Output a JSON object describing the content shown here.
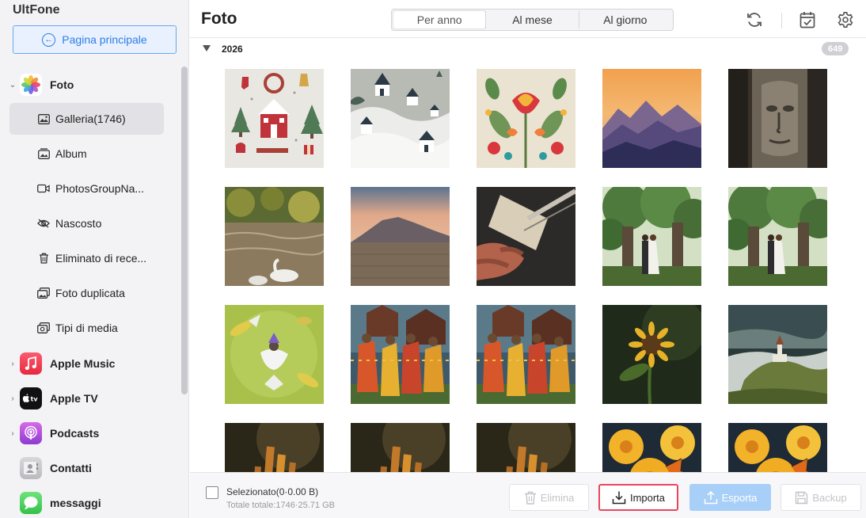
{
  "app": {
    "title": "UltFone",
    "home_button": "Pagina principale"
  },
  "sidebar": {
    "photos_label": "Foto",
    "sub_items": [
      {
        "label": "Galleria(1746)",
        "icon": "gallery-icon",
        "active": true
      },
      {
        "label": "Album",
        "icon": "album-icon"
      },
      {
        "label": "PhotosGroupNa...",
        "icon": "video-icon"
      },
      {
        "label": "Nascosto",
        "icon": "eye-hidden-icon"
      },
      {
        "label": "Eliminato di rece...",
        "icon": "trash-icon"
      },
      {
        "label": "Foto duplicata",
        "icon": "duplicate-photo-icon"
      },
      {
        "label": "Tipi di media",
        "icon": "media-types-icon"
      }
    ],
    "categories": [
      {
        "label": "Apple Music",
        "icon": "apple-music-icon"
      },
      {
        "label": "Apple TV",
        "icon": "apple-tv-icon"
      },
      {
        "label": "Podcasts",
        "icon": "podcasts-icon"
      },
      {
        "label": "Contatti",
        "icon": "contacts-icon"
      },
      {
        "label": "messaggi",
        "icon": "messages-icon"
      }
    ]
  },
  "header": {
    "title": "Foto",
    "tabs": [
      "Per anno",
      "Al mese",
      "Al giorno"
    ],
    "active_tab": "Per anno"
  },
  "gallery": {
    "year": "2026",
    "count": "649",
    "thumbnails": [
      "christmas-pattern",
      "snowy-houses",
      "floral-folk",
      "mountain-sunset",
      "stone-face",
      "river-swans",
      "desert-mountain",
      "guitar-hands",
      "wedding-tree",
      "wedding-tree",
      "fairy-circle",
      "balinese-dancers",
      "balinese-dancers",
      "sunflower",
      "hill-church",
      "wheat-macro",
      "wheat-macro",
      "wheat-macro",
      "butterfly-flower",
      "butterfly-flower"
    ]
  },
  "footer": {
    "selected_text": "Selezionato(0·0.00 B)",
    "total_text": "Totale totale:1746·25.71 GB",
    "buttons": {
      "elimina": "Elimina",
      "importa": "Importa",
      "esporta": "Esporta",
      "backup": "Backup"
    }
  },
  "colors": {
    "accent": "#2f7de8",
    "highlight": "#e8465e",
    "export": "#a8cff8"
  }
}
